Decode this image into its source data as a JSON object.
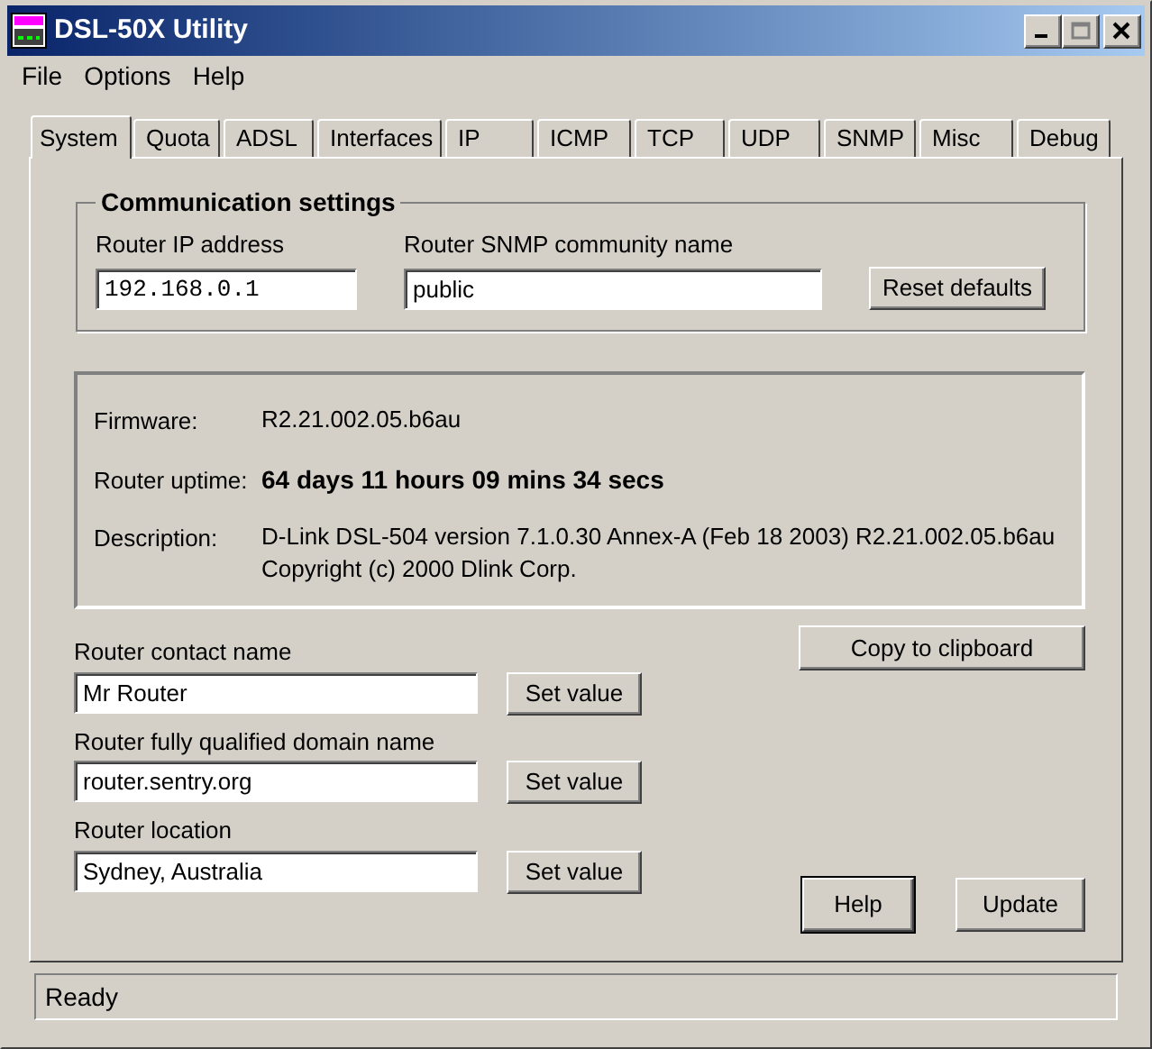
{
  "window": {
    "title": "DSL-50X Utility"
  },
  "menu": [
    "File",
    "Options",
    "Help"
  ],
  "tabs": [
    {
      "label": "System",
      "selected": true
    },
    {
      "label": "Quota",
      "selected": false
    },
    {
      "label": "ADSL",
      "selected": false
    },
    {
      "label": "Interfaces",
      "selected": false
    },
    {
      "label": "IP",
      "selected": false
    },
    {
      "label": "ICMP",
      "selected": false
    },
    {
      "label": "TCP",
      "selected": false
    },
    {
      "label": "UDP",
      "selected": false
    },
    {
      "label": "SNMP",
      "selected": false
    },
    {
      "label": "Misc",
      "selected": false
    },
    {
      "label": "Debug",
      "selected": false
    }
  ],
  "communication": {
    "title": "Communication settings",
    "ip_label": "Router IP address",
    "ip_value": "192.168.0.1",
    "community_label": "Router SNMP community name",
    "community_value": "public",
    "reset_button": "Reset defaults"
  },
  "info": [
    {
      "label": "Firmware:",
      "value": "R2.21.002.05.b6au",
      "bold": false
    },
    {
      "label": "Router uptime:",
      "value": "64 days 11 hours 09 mins 34 secs",
      "bold": true
    },
    {
      "label": "Description:",
      "value": "D-Link DSL-504 version 7.1.0.30 Annex-A (Feb 18 2003) R2.21.002.05.b6au\nCopyright (c) 2000 Dlink Corp.",
      "bold": false
    }
  ],
  "copy_button": "Copy to clipboard",
  "settings": [
    {
      "label": "Router contact name",
      "value": "Mr Router",
      "button": "Set value"
    },
    {
      "label": "Router fully qualified domain name",
      "value": "router.sentry.org",
      "button": "Set value"
    },
    {
      "label": "Router location",
      "value": "Sydney, Australia",
      "button": "Set value"
    }
  ],
  "buttons": {
    "help": "Help",
    "update": "Update"
  },
  "status_bar": "Ready"
}
